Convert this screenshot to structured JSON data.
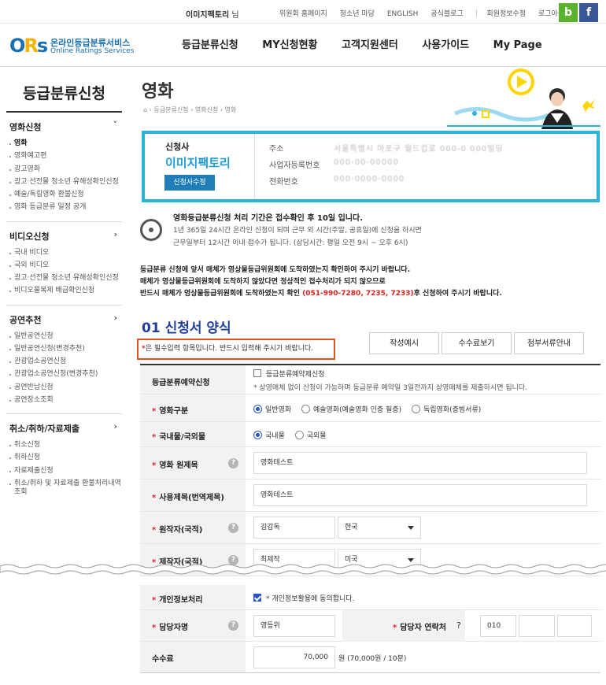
{
  "topbar": {
    "user_name": "이미지팩토리",
    "user_suffix": "님",
    "links": [
      "위원회 홈페이지",
      "청소년 마당",
      "ENGLISH",
      "공식블로그"
    ],
    "account_links": [
      "회원정보수정",
      "로그아웃"
    ],
    "sns": {
      "blog": "b",
      "facebook": "f"
    }
  },
  "logo": {
    "mark": "ORs",
    "title": "온라인등급분류서비스",
    "subtitle": "Online Ratings Services"
  },
  "gnb": [
    "등급분류신청",
    "MY신청현황",
    "고객지원센터",
    "사용가이드",
    "My Page"
  ],
  "lnb": {
    "title": "등급분류신청",
    "groups": [
      {
        "label": "영화신청",
        "arrow": "˅",
        "items": [
          "영화",
          "영화예고편",
          "광고영화",
          "광고·선전물 청소년 유해성확인신청",
          "예술/독립영화 환불신청",
          "영화 등급분류 일정 공개"
        ],
        "active": 0
      },
      {
        "label": "비디오신청",
        "arrow": "›",
        "items": [
          "국내 비디오",
          "국외 비디오",
          "광고·선전물 청소년 유해성확인신청",
          "비디오물복제 배급확인신청"
        ]
      },
      {
        "label": "공연추천",
        "arrow": "›",
        "items": [
          "일반공연신청",
          "일반공연신청(변경추천)",
          "관광업소공연신청",
          "관광업소공연신청(변경추천)",
          "공연반납신청",
          "공연장소조회"
        ]
      },
      {
        "label": "취소/취하/자료제출",
        "arrow": "›",
        "items": [
          "취소신청",
          "취하신청",
          "자료제출신청",
          "취소/취하 및 자료제출 환불처리내역조회"
        ]
      }
    ]
  },
  "page": {
    "title": "영화",
    "breadcrumb": [
      "등급분류신청",
      "영화신청",
      "영화"
    ]
  },
  "applicant": {
    "label": "신청사",
    "name": "이미지팩토리",
    "edit_button": "신청사수정",
    "rows": [
      {
        "label": "주소",
        "value": "서울특별시 마포구 월드컵로 000-0 000빌딩"
      },
      {
        "label": "사업자등록번호",
        "value": "000-00-00000"
      },
      {
        "label": "전화번호",
        "value": "000-0000-0000"
      }
    ]
  },
  "notice": {
    "title": "영화등급분류신청 처리 기간은 접수확인 후 10일 입니다.",
    "line1": "1년 365일 24시간 온라인 신청이 되며 근무 외 시간(주말, 공휴일)에 신청을 하시면",
    "line2": "근무일부터 12시간 이내 접수가 됩니다. (상담시간: 평일 오전 9시 ~ 오후 6시)",
    "para1": "등급분류 신청에 앞서 매체가 영상물등급위원회에 도착하였는지 확인하여 주시기 바랍니다.",
    "para2": "매체가 영상물등급위원회에 도착하지 않았다면 정상적인 접수처리가 되지 않으므로",
    "para3a": "반드시 매체가 영상물등급위원회에 도착하였는지 확인 ",
    "para3_phone": "(051-990-7280, 7235, 7233)",
    "para3b": "후 신청하여 주시기 바랍니다."
  },
  "section": {
    "title": "01 신청서 양식",
    "required_star": "*",
    "required_note": "은 필수입력 항목입니다. 반드시 입력해 주시기 바랍니다.",
    "tab_buttons": [
      "작성예시",
      "수수료보기",
      "첨부서류안내"
    ]
  },
  "form": {
    "reservation": {
      "label": "등급분류예약신청",
      "checkbox": "등급분류예약제신청",
      "note": "* 상영매체 없이 신청이 가능하며 등급분류 예약일 3일전까지 상영매체를 제출하시면 됩니다."
    },
    "film_type": {
      "label": "영화구분",
      "options": [
        "일반영화",
        "예술영화(예술영화 인증 필증)",
        "독립영화(증빙서류)"
      ],
      "selected": "일반영화"
    },
    "origin": {
      "label": "국내물/국외물",
      "options": [
        "국내물",
        "국외물"
      ],
      "selected": "국내물"
    },
    "original_title": {
      "label": "영화 원제목",
      "value": "영화테스트"
    },
    "used_title": {
      "label": "사용제목(번역제목)",
      "value": "영화테스트"
    },
    "author": {
      "label": "원작자(국적)",
      "value": "김감독",
      "country": "한국"
    },
    "producer": {
      "label": "제작자(국적)",
      "value": "최제작",
      "country": "미국"
    },
    "privacy": {
      "label": "개인정보처리",
      "text": "* 개인정보활용에 동의합니다.",
      "checked": true
    },
    "manager": {
      "label": "담당자명",
      "value": "영등위"
    },
    "manager_contact": {
      "label": "담당자 연락처",
      "phone1": "010",
      "phone2": "",
      "phone3": ""
    },
    "fee": {
      "label": "수수료",
      "value": "70,000",
      "unit": "원 (70,000원 / 10분)"
    }
  },
  "colors": {
    "accent": "#1e9bd1",
    "border_cyan": "#2bb3d9",
    "section_blue": "#1e3f9e",
    "required_red": "#e0211b",
    "highlight_orange": "#e0501b"
  },
  "icons": {
    "help": "question-circle-icon",
    "reel": "film-reel-icon",
    "home": "home-icon"
  }
}
